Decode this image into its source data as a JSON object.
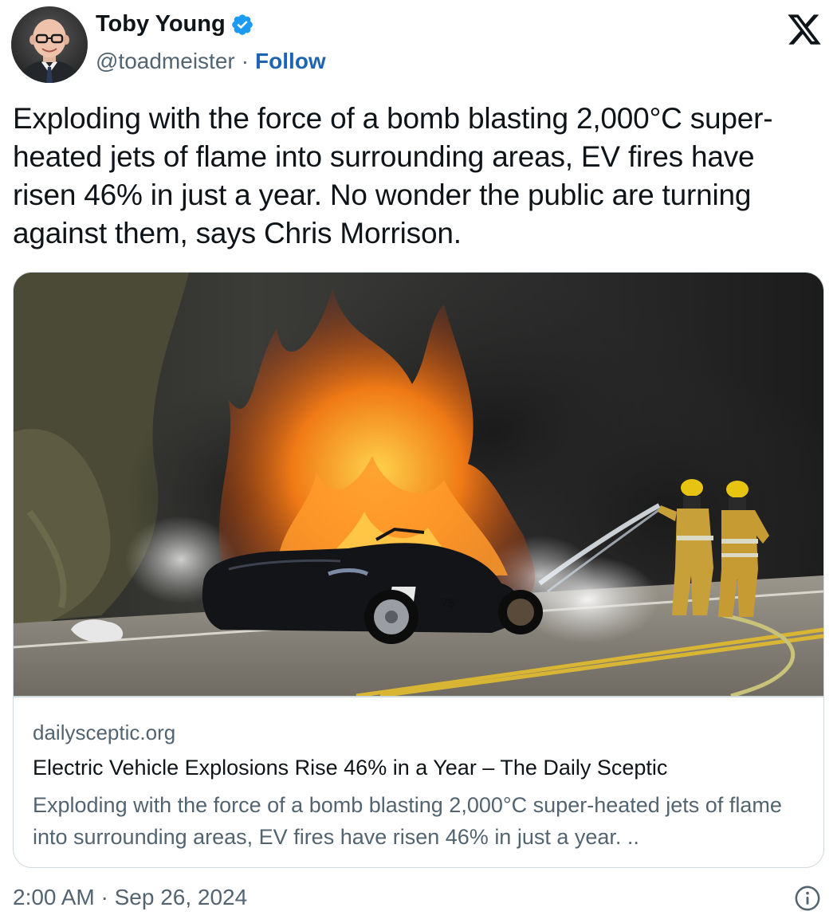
{
  "author": {
    "name": "Toby Young",
    "handle": "@toadmeister",
    "separator": "·",
    "follow_label": "Follow",
    "verified": true
  },
  "tweet": {
    "text": "Exploding with the force of a bomb blasting 2,000°C super-heated jets of flame into surrounding areas, EV fires have risen 46% in just a year. No wonder the public are turning against them, says Chris Morrison."
  },
  "card": {
    "domain": "dailysceptic.org",
    "title": "Electric Vehicle Explosions Rise 46% in a Year – The Daily Sceptic",
    "description": "Exploding with the force of a bomb blasting 2,000°C super-heated jets of flame into surrounding areas, EV fires have risen 46% in just a year. ..",
    "image_alt": "A black convertible sports car on fire with orange flames and black smoke, two firefighters spraying water from a hose"
  },
  "footer": {
    "timestamp": "2:00 AM · Sep 26, 2024"
  },
  "colors": {
    "text_primary": "#0f1419",
    "text_secondary": "#536471",
    "follow_link": "#1d64b3",
    "verified_badge": "#1d9bf0",
    "border": "#cfd9de"
  },
  "icons": {
    "logo": "x-logo-icon",
    "verified": "verified-badge-icon",
    "info": "info-circle-icon"
  }
}
